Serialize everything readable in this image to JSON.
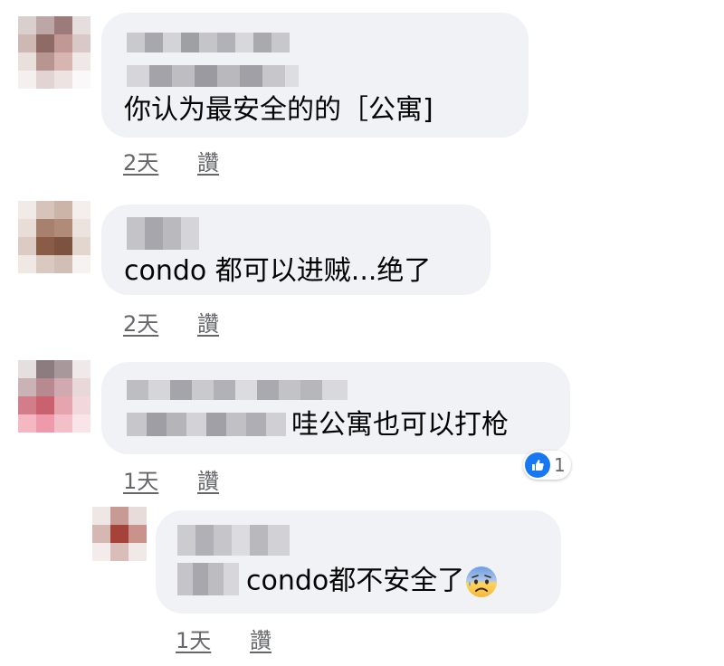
{
  "colors": {
    "bubble": "#f0f2f5",
    "meta": "#65676b",
    "text": "#050505",
    "like": "#1877f2"
  },
  "comments": [
    {
      "text": "你认为最安全的的［公寓]",
      "time": "2天",
      "action": "讚"
    },
    {
      "text": "condo 都可以进贼...绝了",
      "time": "2天",
      "action": "讚"
    },
    {
      "text": "哇公寓也可以打枪",
      "time": "1天",
      "action": "讚",
      "reaction": {
        "icon": "thumbs-up-icon",
        "count": "1"
      }
    },
    {
      "text": "condo都不安全了",
      "emoji": "anxious-face-with-sweat-icon",
      "time": "1天",
      "action": "讚"
    }
  ]
}
